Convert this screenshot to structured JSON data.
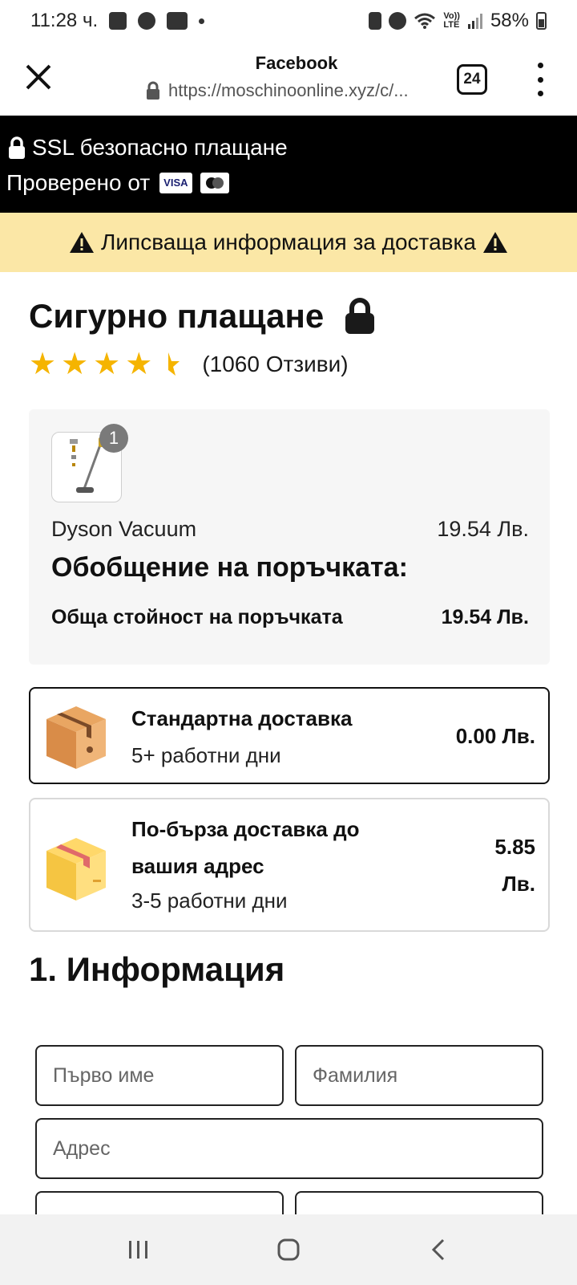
{
  "status_bar": {
    "time": "11:28 ч.",
    "battery": "58%"
  },
  "browser": {
    "site_title": "Facebook",
    "url": "https://moschinoonline.xyz/c/...",
    "tabs_count": "24"
  },
  "ssl_banner": {
    "line1": "SSL безопасно плащане",
    "line2": "Проверено от",
    "visa_label": "VISA"
  },
  "warning_banner": {
    "text": "Липсваща информация за доставка"
  },
  "checkout": {
    "title": "Сигурно плащане",
    "rating": 4.5,
    "reviews_text": "(1060 Отзиви)"
  },
  "order_summary": {
    "quantity": "1",
    "product_name": "Dyson Vacuum",
    "product_price": "19.54 Лв.",
    "heading": "Обобщение на поръчката:",
    "total_label": "Обща стойност на поръчката",
    "total_value": "19.54 Лв."
  },
  "shipping": {
    "options": [
      {
        "name": "Стандартна доставка",
        "days": "5+ работни дни",
        "price": "0.00 Лв.",
        "selected": true
      },
      {
        "name": "По-бърза доставка до вашия адрес",
        "days": "3-5 работни дни",
        "price": "5.85 Лв.",
        "selected": false
      }
    ]
  },
  "info_section": {
    "title": "1. Информация",
    "first_name_placeholder": "Първо име",
    "last_name_placeholder": "Фамилия",
    "address_placeholder": "Адрес"
  },
  "colors": {
    "warning_bg": "#fbe7a6",
    "star": "#f5b400",
    "banner_bg": "#000000"
  }
}
